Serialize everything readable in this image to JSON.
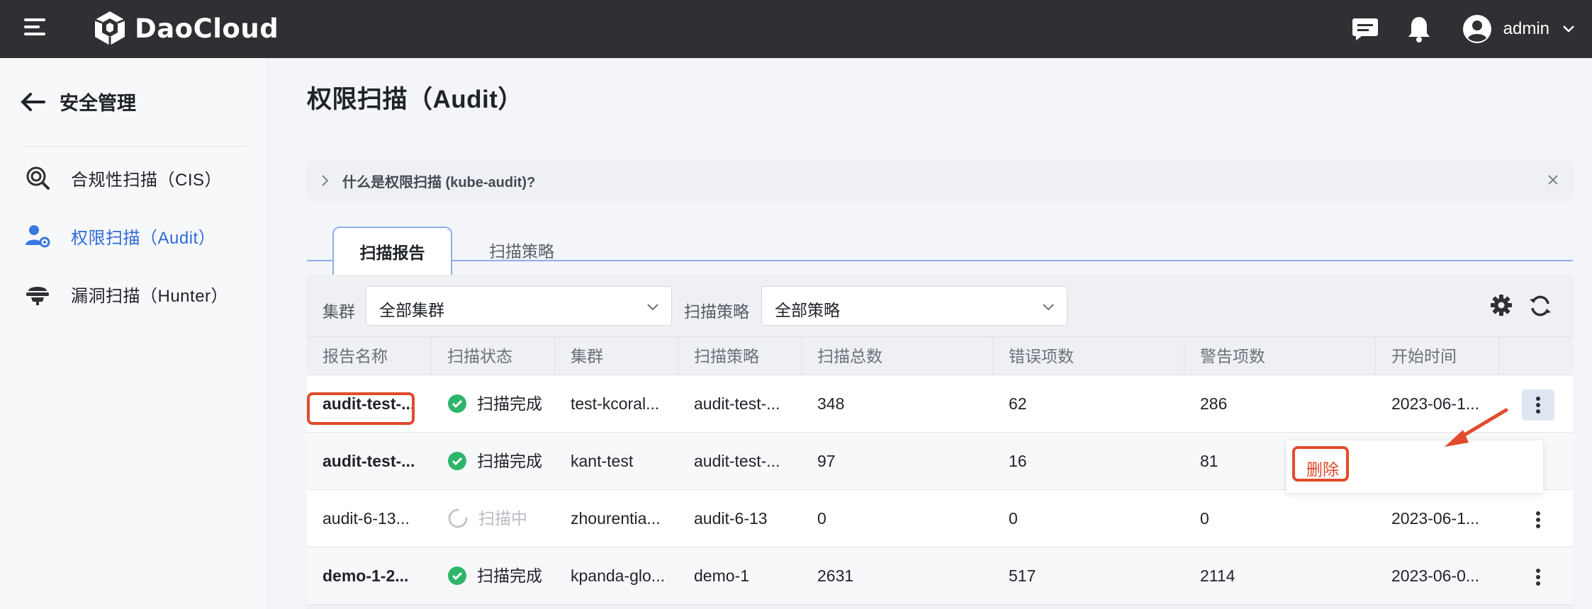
{
  "header": {
    "brand": "DaoCloud",
    "user": "admin",
    "icons": [
      "menu-icon",
      "message-icon",
      "bell-icon",
      "user-avatar-icon",
      "chevron-down-icon"
    ]
  },
  "sidebar": {
    "back_title": "安全管理",
    "items": [
      {
        "label": "合规性扫描（CIS）",
        "icon": "compliance-scan-icon",
        "active": false
      },
      {
        "label": "权限扫描（Audit）",
        "icon": "audit-user-icon",
        "active": true
      },
      {
        "label": "漏洞扫描（Hunter）",
        "icon": "vuln-scan-icon",
        "active": false
      }
    ]
  },
  "page": {
    "title": "权限扫描（Audit）",
    "notice": "什么是权限扫描 (kube-audit)?"
  },
  "tabs": [
    "扫描报告",
    "扫描策略"
  ],
  "filters": {
    "cluster_label": "集群",
    "cluster_value": "全部集群",
    "policy_label": "扫描策略",
    "policy_value": "全部策略"
  },
  "table": {
    "columns": [
      "报告名称",
      "扫描状态",
      "集群",
      "扫描策略",
      "扫描总数",
      "错误项数",
      "警告项数",
      "开始时间"
    ],
    "rows": [
      {
        "name": "audit-test-...",
        "status": "扫描完成",
        "cluster": "test-kcoral...",
        "policy": "audit-test-...",
        "total": "348",
        "errors": "62",
        "warnings": "286",
        "start": "2023-06-1..."
      },
      {
        "name": "audit-test-...",
        "status": "扫描完成",
        "cluster": "kant-test",
        "policy": "audit-test-...",
        "total": "97",
        "errors": "16",
        "warnings": "81",
        "start": ""
      },
      {
        "name": "audit-6-13...",
        "status": "扫描中",
        "cluster": "zhourentia...",
        "policy": "audit-6-13",
        "total": "0",
        "errors": "0",
        "warnings": "0",
        "start": "2023-06-1..."
      },
      {
        "name": "demo-1-2...",
        "status": "扫描完成",
        "cluster": "kpanda-glo...",
        "policy": "demo-1",
        "total": "2631",
        "errors": "517",
        "warnings": "2114",
        "start": "2023-06-0..."
      }
    ]
  },
  "row_menu": {
    "delete_label": "删除"
  },
  "colors": {
    "topbar": "#2f3033",
    "accent": "#2f6bda",
    "success": "#2fb56a",
    "danger": "#e14b2c"
  }
}
